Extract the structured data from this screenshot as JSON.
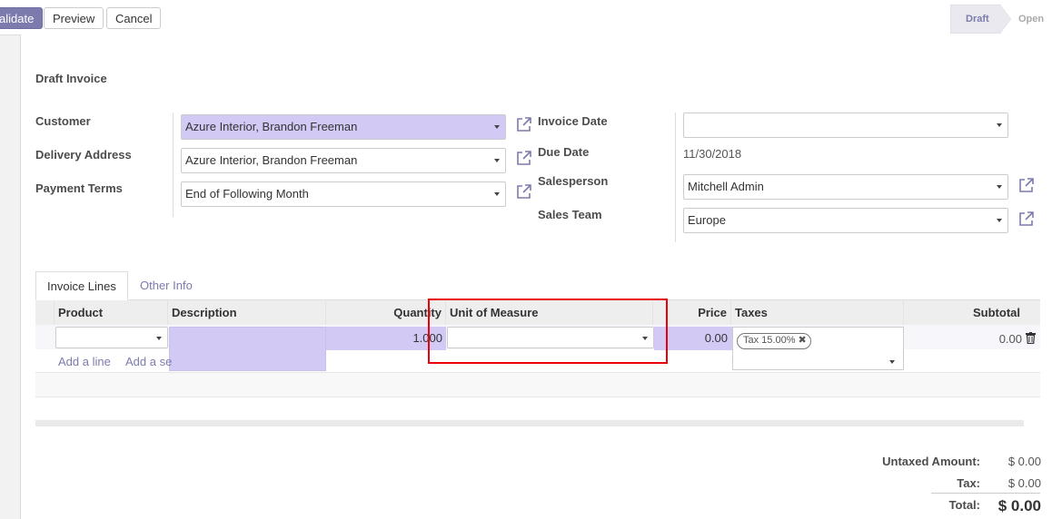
{
  "toolbar": {
    "validate_label": "alidate",
    "preview_label": "Preview",
    "cancel_label": "Cancel"
  },
  "statusbar": {
    "draft": "Draft",
    "open": "Open"
  },
  "form": {
    "title": "Draft Invoice",
    "customer_label": "Customer",
    "customer_value": "Azure Interior, Brandon Freeman",
    "delivery_label": "Delivery Address",
    "delivery_value": "Azure Interior, Brandon Freeman",
    "payment_terms_label": "Payment Terms",
    "payment_terms_value": "End of Following Month",
    "invoice_date_label": "Invoice Date",
    "invoice_date_value": "",
    "due_date_label": "Due Date",
    "due_date_value": "11/30/2018",
    "salesperson_label": "Salesperson",
    "salesperson_value": "Mitchell Admin",
    "sales_team_label": "Sales Team",
    "sales_team_value": "Europe"
  },
  "tabs": [
    {
      "label": "Invoice Lines",
      "active": true
    },
    {
      "label": "Other Info",
      "active": false
    }
  ],
  "lines": {
    "columns": {
      "product": "Product",
      "description": "Description",
      "quantity": "Quantity",
      "uom": "Unit of Measure",
      "price": "Price",
      "taxes": "Taxes",
      "subtotal": "Subtotal"
    },
    "row": {
      "product": "",
      "description": "",
      "quantity": "1.000",
      "uom": "",
      "price": "0.00",
      "tax_tag": "Tax 15.00%",
      "subtotal": "0.00"
    },
    "add_line": "Add a line",
    "add_section": "Add a se"
  },
  "totals": {
    "untaxed_label": "Untaxed Amount:",
    "untaxed_value": "$ 0.00",
    "tax_label": "Tax:",
    "tax_value": "$ 0.00",
    "total_label": "Total:",
    "total_value": "$ 0.00"
  },
  "colors": {
    "accent": "#7c7bad",
    "required_field": "#d2c9f5",
    "highlight_box": "#e8000b"
  }
}
